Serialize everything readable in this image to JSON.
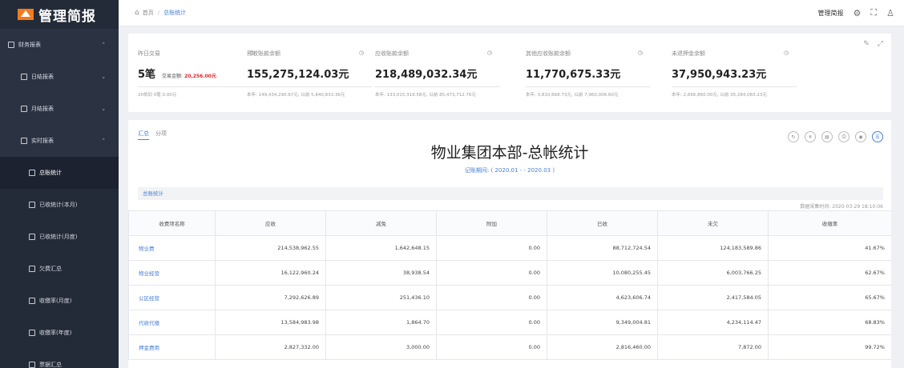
{
  "app": {
    "title": "管理简报"
  },
  "sidebar": {
    "items": [
      {
        "label": "财务报表",
        "level": 0,
        "expanded": true
      },
      {
        "label": "日结报表",
        "level": 1,
        "expanded": false
      },
      {
        "label": "月结报表",
        "level": 1,
        "expanded": false
      },
      {
        "label": "实时报表",
        "level": 1,
        "expanded": true
      },
      {
        "label": "总账统计",
        "level": 2,
        "active": true
      },
      {
        "label": "已收统计(本月)",
        "level": 2
      },
      {
        "label": "已收统计(月度)",
        "level": 2
      },
      {
        "label": "欠费汇总",
        "level": 2
      },
      {
        "label": "收缴率(月度)",
        "level": 2
      },
      {
        "label": "收缴率(年度)",
        "level": 2
      },
      {
        "label": "票据汇总",
        "level": 2
      }
    ]
  },
  "header": {
    "breadcrumb": [
      "首页",
      "总账统计"
    ],
    "user": "管理简报"
  },
  "stats": [
    {
      "title": "昨日交易",
      "value": "5笔",
      "extra_label": "交易金额:",
      "extra_value": "20,256.00元",
      "sub": "20依旧 0笔 0.00元"
    },
    {
      "title": "预收账款余额",
      "value": "155,275,124.03元",
      "sub": "本年: 149,434,290.67元, 以前 5,840,833.36元"
    },
    {
      "title": "应收账款余额",
      "value": "218,489,032.34元",
      "sub": "本年: 133,015,319.58元, 以前 85,473,712.76元"
    },
    {
      "title": "其他应收账款余额",
      "value": "11,770,675.33元",
      "sub": "本年: 3,810,668.73元, 以前 7,960,006.60元"
    },
    {
      "title": "未退押金余额",
      "value": "37,950,943.23元",
      "sub": "本年: 2,666,860.00元, 以前 35,284,083.23元"
    }
  ],
  "main": {
    "tabs": [
      "汇总",
      "分项"
    ],
    "title": "物业集团本部-总帐统计",
    "period": "记账期间: ( 2020.01 -  - 2020.03 )",
    "section": "总账统计",
    "collect_time": "数据采集时间: 2020-03-29 18:10:06",
    "tools": [
      "↻",
      "¥",
      "▤",
      "⎙",
      "◉",
      "☰"
    ],
    "table": {
      "headers": [
        "收费项名称",
        "应收",
        "减免",
        "附加",
        "已收",
        "未欠",
        "收缴率"
      ],
      "rows": [
        [
          "物业费",
          "214,538,962.55",
          "1,642,648.15",
          "0.00",
          "88,712,724.54",
          "124,183,589.86",
          "41.67%"
        ],
        [
          "物业经营",
          "16,122,960.24",
          "38,938.54",
          "0.00",
          "10,080,255.45",
          "6,003,766.25",
          "62.67%"
        ],
        [
          "公区经营",
          "7,292,626.89",
          "251,436.10",
          "0.00",
          "4,623,606.74",
          "2,417,584.05",
          "65.67%"
        ],
        [
          "代收代缴",
          "13,584,983.98",
          "1,864.70",
          "0.00",
          "9,349,004.81",
          "4,234,114.47",
          "68.83%"
        ],
        [
          "押金费用",
          "2,827,332.00",
          "3,000.00",
          "0.00",
          "2,816,460.00",
          "7,872.00",
          "99.72%"
        ]
      ]
    }
  }
}
